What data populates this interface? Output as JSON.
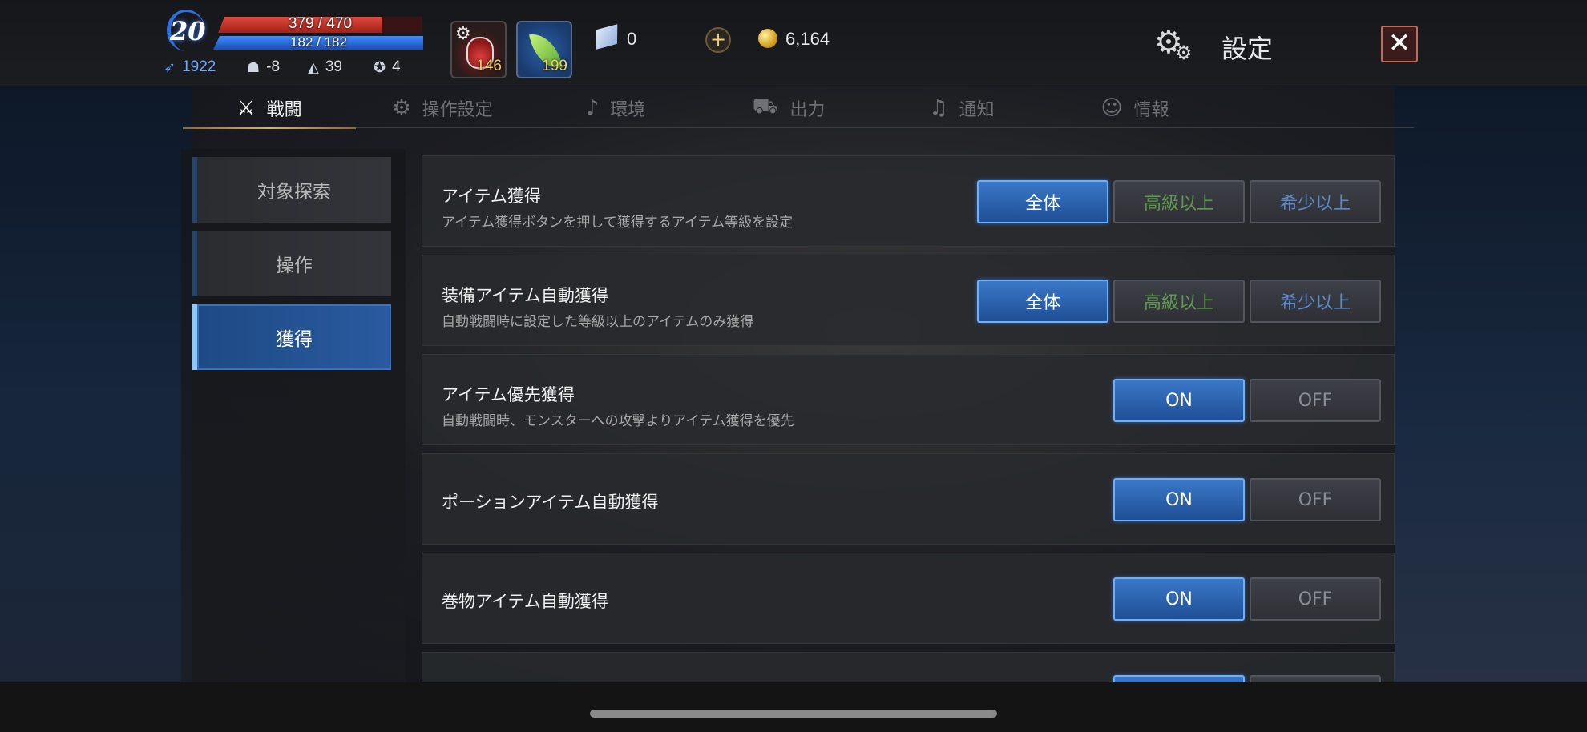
{
  "hud": {
    "level": "20",
    "hp_text": "379 / 470",
    "hp_fraction": 0.804,
    "mp_text": "182 / 182",
    "mp_fraction": 1.0,
    "stats": {
      "speed": "1922",
      "defense": "-8",
      "evasion": "39",
      "reduction": "4"
    },
    "slots": [
      {
        "name": "potion",
        "count": "146"
      },
      {
        "name": "leaf",
        "count": "199"
      }
    ],
    "crystal_count": "0",
    "plus_label": "+",
    "gold_count": "6,164"
  },
  "header": {
    "title": "設定",
    "close_label": "✕"
  },
  "tabs": [
    {
      "label": "戦闘",
      "icon": "crossed-swords-icon",
      "active": true
    },
    {
      "label": "操作設定",
      "icon": "gear-icon",
      "active": false
    },
    {
      "label": "環境",
      "icon": "music-note-icon",
      "active": false
    },
    {
      "label": "出力",
      "icon": "output-icon",
      "active": false
    },
    {
      "label": "通知",
      "icon": "bell-icon",
      "active": false
    },
    {
      "label": "情報",
      "icon": "user-info-icon",
      "active": false
    }
  ],
  "sidebar": {
    "items": [
      {
        "label": "対象探索",
        "active": false
      },
      {
        "label": "操作",
        "active": false
      },
      {
        "label": "獲得",
        "active": true
      }
    ]
  },
  "settings": [
    {
      "title": "アイテム獲得",
      "description": "アイテム獲得ボタンを押して獲得するアイテム等級を設定",
      "options": [
        "全体",
        "高級以上",
        "希少以上"
      ],
      "selected": "全体"
    },
    {
      "title": "装備アイテム自動獲得",
      "description": "自動戦闘時に設定した等級以上のアイテムのみ獲得",
      "options": [
        "全体",
        "高級以上",
        "希少以上"
      ],
      "selected": "全体"
    },
    {
      "title": "アイテム優先獲得",
      "description": "自動戦闘時、モンスターへの攻撃よりアイテム獲得を優先",
      "options": [
        "ON",
        "OFF"
      ],
      "selected": "ON"
    },
    {
      "title": "ポーションアイテム自動獲得",
      "description": "",
      "options": [
        "ON",
        "OFF"
      ],
      "selected": "ON"
    },
    {
      "title": "巻物アイテム自動獲得",
      "description": "",
      "options": [
        "ON",
        "OFF"
      ],
      "selected": "ON"
    }
  ],
  "colors": {
    "accent_blue": "#2a5aa0",
    "hp_red": "#c0302a",
    "mp_blue": "#2f6fe0",
    "tab_underline_gold": "#d8b060"
  }
}
